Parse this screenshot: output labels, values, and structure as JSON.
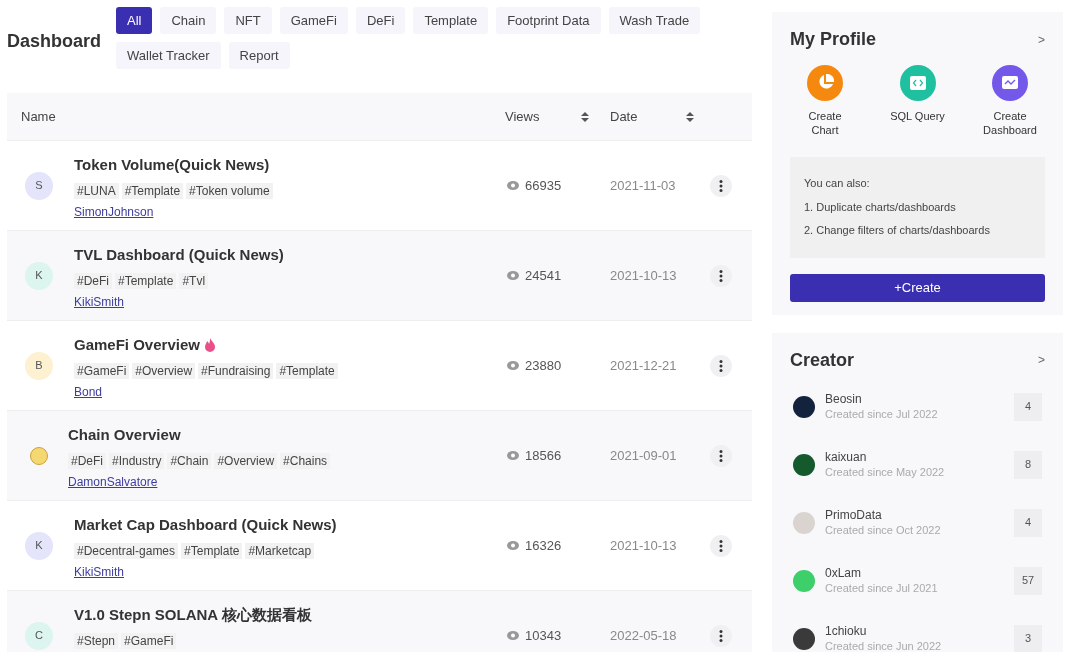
{
  "page_title": "Dashboard",
  "filters": [
    {
      "label": "All",
      "selected": true
    },
    {
      "label": "Chain",
      "selected": false
    },
    {
      "label": "NFT",
      "selected": false
    },
    {
      "label": "GameFi",
      "selected": false
    },
    {
      "label": "DeFi",
      "selected": false
    },
    {
      "label": "Template",
      "selected": false
    },
    {
      "label": "Footprint Data",
      "selected": false
    },
    {
      "label": "Wash Trade",
      "selected": false
    },
    {
      "label": "Wallet Tracker",
      "selected": false
    },
    {
      "label": "Report",
      "selected": false
    }
  ],
  "table": {
    "columns": [
      {
        "label": "Name",
        "sortable": false
      },
      {
        "label": "Views",
        "sortable": true
      },
      {
        "label": "Date",
        "sortable": true
      }
    ],
    "rows": [
      {
        "avatar": {
          "kind": "letter",
          "letter": "S",
          "color": "#e4e4fb"
        },
        "title": "Token Volume(Quick News)",
        "hot": false,
        "tags": [
          "#LUNA",
          "#Template",
          "#Token volume"
        ],
        "author": "SimonJohnson",
        "views": "66935",
        "date": "2021-11-03"
      },
      {
        "avatar": {
          "kind": "letter",
          "letter": "K",
          "color": "#dcf5ef"
        },
        "title": "TVL Dashboard (Quick News)",
        "hot": false,
        "tags": [
          "#DeFi",
          "#Template",
          "#Tvl"
        ],
        "author": "KikiSmith",
        "views": "24541",
        "date": "2021-10-13"
      },
      {
        "avatar": {
          "kind": "letter",
          "letter": "B",
          "color": "#fdf1d2"
        },
        "title": "GameFi Overview",
        "hot": true,
        "tags": [
          "#GameFi",
          "#Overview",
          "#Fundraising",
          "#Template"
        ],
        "author": "Bond",
        "views": "23880",
        "date": "2021-12-21"
      },
      {
        "avatar": {
          "kind": "image",
          "color": "#f6d872"
        },
        "title": "Chain Overview",
        "hot": false,
        "tags": [
          "#DeFi",
          "#Industry",
          "#Chain",
          "#Overview",
          "#Chains"
        ],
        "author": "DamonSalvatore",
        "views": "18566",
        "date": "2021-09-01"
      },
      {
        "avatar": {
          "kind": "letter",
          "letter": "K",
          "color": "#e4e4fb"
        },
        "title": "Market Cap Dashboard (Quick News)",
        "hot": false,
        "tags": [
          "#Decentral-games",
          "#Template",
          "#Marketcap"
        ],
        "author": "KikiSmith",
        "views": "16326",
        "date": "2021-10-13"
      },
      {
        "avatar": {
          "kind": "letter",
          "letter": "C",
          "color": "#dcf5ef"
        },
        "title": "V1.0 Stepn SOLANA 核心数据看板",
        "hot": false,
        "tags": [
          "#Stepn",
          "#GameFi"
        ],
        "views": "10343",
        "date": "2022-05-18"
      }
    ]
  },
  "profile": {
    "title": "My Profile",
    "more": ">",
    "actions": [
      {
        "kind": "chart",
        "label": "Create Chart",
        "color": "#f5890f"
      },
      {
        "kind": "sql",
        "label": "SQL Query",
        "color": "#1fc0a0"
      },
      {
        "kind": "dashboard",
        "label": "Create Dashboard",
        "color": "#7458ea"
      }
    ],
    "tips": [
      "You can also:",
      "1. Duplicate charts/dashboards",
      "2. Change filters of charts/dashboards"
    ],
    "create_button": "+Create"
  },
  "creators": {
    "title": "Creator",
    "more": ">",
    "items": [
      {
        "name": "Beosin",
        "since": "Created since Jul 2022",
        "count": "4",
        "color": "#13223d"
      },
      {
        "name": "kaixuan",
        "since": "Created since May 2022",
        "count": "8",
        "color": "#145a2c"
      },
      {
        "name": "PrimoData",
        "since": "Created since Oct 2022",
        "count": "4",
        "color": "#d9d4d0"
      },
      {
        "name": "0xLam",
        "since": "Created since Jul 2021",
        "count": "57",
        "color": "#3ccf6a"
      },
      {
        "name": "1chioku",
        "since": "Created since Jun 2022",
        "count": "3",
        "color": "#3a3a3a"
      }
    ]
  }
}
